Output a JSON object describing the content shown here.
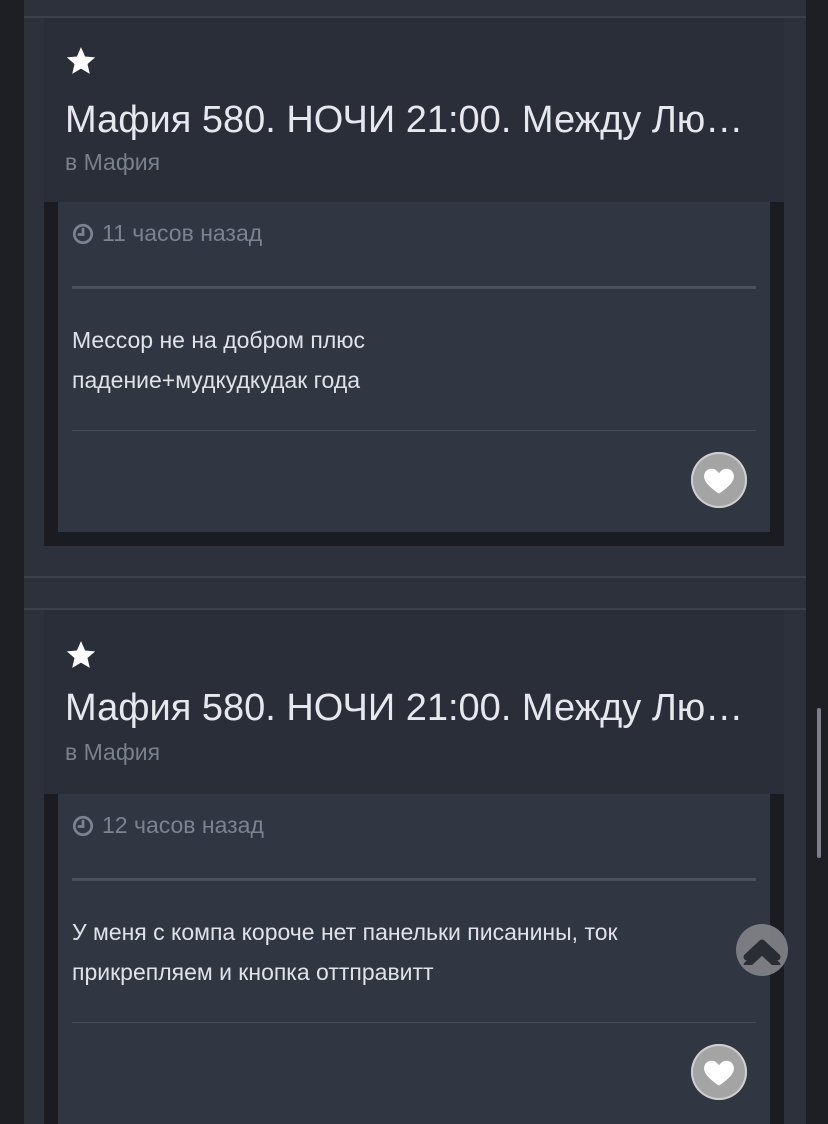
{
  "posts": [
    {
      "title": "Мафия 580. НОЧИ 21:00. Между Лю…",
      "forum": "в Мафия",
      "time": "11 часов назад",
      "text_line1": "Мессор не на добром плюс",
      "text_line2": "падение+мудкудкудак года"
    },
    {
      "title": "Мафия 580. НОЧИ 21:00. Между Лю…",
      "forum": "в Мафия",
      "time": "12 часов назад",
      "text_line1": "У меня с компа короче нет панельки писанины, ток",
      "text_line2": "прикрепляем и кнопка оттправитт"
    }
  ],
  "icons": {
    "star": "star-icon",
    "clock": "clock-icon",
    "like": "heart-icon",
    "scroll_top": "chevron-up-icon"
  },
  "colors": {
    "background": "#1d1f25",
    "panel": "#2c313c",
    "card": "#292e39",
    "comment": "#313643",
    "title": "#e6e8ed",
    "muted": "#7a808c"
  }
}
